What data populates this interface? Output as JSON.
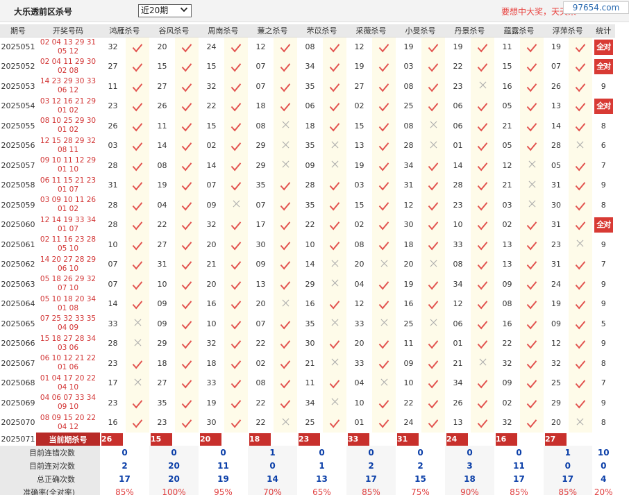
{
  "header": {
    "title": "大乐透前区杀号",
    "period_select": "近20期",
    "slogan": "要想中大奖，天天来",
    "watermark": "97654.com"
  },
  "columns": {
    "issue": "期号",
    "draw": "开奖号码",
    "experts": [
      "鸿雁杀号",
      "谷风杀号",
      "周南杀号",
      "蒹之杀号",
      "芣苡杀号",
      "采薇杀号",
      "小旻杀号",
      "丹景杀号",
      "蕴露杀号",
      "浮萍杀号"
    ],
    "stat": "统计"
  },
  "rows": [
    {
      "issue": "2025051",
      "draw1": "02 04 13 29 31",
      "draw2": "05 12",
      "kills": [
        "32",
        "20",
        "24",
        "12",
        "08",
        "12",
        "19",
        "19",
        "11",
        "19"
      ],
      "ok": [
        1,
        1,
        1,
        1,
        1,
        1,
        1,
        1,
        1,
        1
      ],
      "stat": "全对",
      "all": true
    },
    {
      "issue": "2025052",
      "draw1": "02 04 11 29 30",
      "draw2": "02 08",
      "kills": [
        "27",
        "15",
        "15",
        "07",
        "34",
        "19",
        "03",
        "22",
        "15",
        "07"
      ],
      "ok": [
        1,
        1,
        1,
        1,
        1,
        1,
        1,
        1,
        1,
        1
      ],
      "stat": "全对",
      "all": true
    },
    {
      "issue": "2025053",
      "draw1": "14 23 29 30 33",
      "draw2": "06 12",
      "kills": [
        "11",
        "27",
        "32",
        "07",
        "35",
        "27",
        "08",
        "23",
        "16",
        "26"
      ],
      "ok": [
        1,
        1,
        1,
        1,
        1,
        1,
        1,
        0,
        1,
        1
      ],
      "stat": "9",
      "all": false
    },
    {
      "issue": "2025054",
      "draw1": "03 12 16 21 29",
      "draw2": "01 02",
      "kills": [
        "23",
        "26",
        "22",
        "18",
        "06",
        "02",
        "25",
        "06",
        "05",
        "13"
      ],
      "ok": [
        1,
        1,
        1,
        1,
        1,
        1,
        1,
        1,
        1,
        1
      ],
      "stat": "全对",
      "all": true
    },
    {
      "issue": "2025055",
      "draw1": "08 10 25 29 30",
      "draw2": "01 02",
      "kills": [
        "26",
        "11",
        "15",
        "08",
        "18",
        "15",
        "08",
        "06",
        "21",
        "14"
      ],
      "ok": [
        1,
        1,
        1,
        0,
        1,
        1,
        0,
        1,
        1,
        1
      ],
      "stat": "8",
      "all": false
    },
    {
      "issue": "2025056",
      "draw1": "12 15 28 29 32",
      "draw2": "08 11",
      "kills": [
        "03",
        "14",
        "02",
        "29",
        "35",
        "13",
        "28",
        "01",
        "05",
        "28"
      ],
      "ok": [
        1,
        1,
        1,
        0,
        0,
        1,
        0,
        1,
        1,
        0
      ],
      "stat": "6",
      "all": false
    },
    {
      "issue": "2025057",
      "draw1": "09 10 11 12 29",
      "draw2": "01 10",
      "kills": [
        "28",
        "08",
        "14",
        "29",
        "09",
        "19",
        "34",
        "14",
        "12",
        "05"
      ],
      "ok": [
        1,
        1,
        1,
        0,
        0,
        1,
        1,
        1,
        0,
        1
      ],
      "stat": "7",
      "all": false
    },
    {
      "issue": "2025058",
      "draw1": "06 11 15 21 23",
      "draw2": "01 07",
      "kills": [
        "31",
        "19",
        "07",
        "35",
        "28",
        "03",
        "31",
        "28",
        "21",
        "31"
      ],
      "ok": [
        1,
        1,
        1,
        1,
        1,
        1,
        1,
        1,
        0,
        1
      ],
      "stat": "9",
      "all": false
    },
    {
      "issue": "2025059",
      "draw1": "03 09 10 11 26",
      "draw2": "01 02",
      "kills": [
        "28",
        "04",
        "09",
        "07",
        "35",
        "15",
        "12",
        "23",
        "03",
        "30"
      ],
      "ok": [
        1,
        1,
        0,
        1,
        1,
        1,
        1,
        1,
        0,
        1
      ],
      "stat": "8",
      "all": false
    },
    {
      "issue": "2025060",
      "draw1": "12 14 19 33 34",
      "draw2": "01 07",
      "kills": [
        "28",
        "22",
        "32",
        "17",
        "22",
        "02",
        "30",
        "10",
        "02",
        "31"
      ],
      "ok": [
        1,
        1,
        1,
        1,
        1,
        1,
        1,
        1,
        1,
        1
      ],
      "stat": "全对",
      "all": true
    },
    {
      "issue": "2025061",
      "draw1": "02 11 16 23 28",
      "draw2": "05 10",
      "kills": [
        "10",
        "27",
        "20",
        "30",
        "10",
        "08",
        "18",
        "33",
        "13",
        "23"
      ],
      "ok": [
        1,
        1,
        1,
        1,
        1,
        1,
        1,
        1,
        1,
        0
      ],
      "stat": "9",
      "all": false
    },
    {
      "issue": "2025062",
      "draw1": "14 20 27 28 29",
      "draw2": "06 10",
      "kills": [
        "07",
        "31",
        "21",
        "09",
        "14",
        "20",
        "20",
        "08",
        "13",
        "31"
      ],
      "ok": [
        1,
        1,
        1,
        1,
        0,
        0,
        0,
        1,
        1,
        1
      ],
      "stat": "7",
      "all": false
    },
    {
      "issue": "2025063",
      "draw1": "05 18 26 29 32",
      "draw2": "07 10",
      "kills": [
        "07",
        "10",
        "20",
        "13",
        "29",
        "04",
        "19",
        "34",
        "09",
        "24"
      ],
      "ok": [
        1,
        1,
        1,
        1,
        0,
        1,
        1,
        1,
        1,
        1
      ],
      "stat": "9",
      "all": false
    },
    {
      "issue": "2025064",
      "draw1": "05 10 18 20 34",
      "draw2": "01 08",
      "kills": [
        "14",
        "09",
        "16",
        "20",
        "16",
        "12",
        "16",
        "12",
        "08",
        "19"
      ],
      "ok": [
        1,
        1,
        1,
        0,
        1,
        1,
        1,
        1,
        1,
        1
      ],
      "stat": "9",
      "all": false
    },
    {
      "issue": "2025065",
      "draw1": "07 25 32 33 35",
      "draw2": "04 09",
      "kills": [
        "33",
        "09",
        "10",
        "07",
        "35",
        "33",
        "25",
        "06",
        "16",
        "09"
      ],
      "ok": [
        0,
        1,
        1,
        1,
        0,
        0,
        0,
        1,
        1,
        1
      ],
      "stat": "5",
      "all": false
    },
    {
      "issue": "2025066",
      "draw1": "15 18 27 28 34",
      "draw2": "03 06",
      "kills": [
        "28",
        "29",
        "32",
        "22",
        "30",
        "20",
        "11",
        "01",
        "22",
        "12"
      ],
      "ok": [
        0,
        1,
        1,
        1,
        1,
        1,
        1,
        1,
        1,
        1
      ],
      "stat": "9",
      "all": false
    },
    {
      "issue": "2025067",
      "draw1": "06 10 12 21 22",
      "draw2": "01 06",
      "kills": [
        "23",
        "18",
        "18",
        "02",
        "21",
        "33",
        "09",
        "21",
        "32",
        "32"
      ],
      "ok": [
        1,
        1,
        1,
        1,
        0,
        1,
        1,
        0,
        1,
        1
      ],
      "stat": "8",
      "all": false
    },
    {
      "issue": "2025068",
      "draw1": "01 04 17 20 22",
      "draw2": "04 10",
      "kills": [
        "17",
        "27",
        "33",
        "08",
        "11",
        "04",
        "10",
        "34",
        "09",
        "25"
      ],
      "ok": [
        0,
        1,
        1,
        1,
        1,
        0,
        1,
        1,
        1,
        1
      ],
      "stat": "7",
      "all": false
    },
    {
      "issue": "2025069",
      "draw1": "04 06 07 33 34",
      "draw2": "09 10",
      "kills": [
        "23",
        "35",
        "19",
        "22",
        "34",
        "10",
        "22",
        "26",
        "02",
        "29"
      ],
      "ok": [
        1,
        1,
        1,
        1,
        0,
        1,
        1,
        1,
        1,
        1
      ],
      "stat": "9",
      "all": false
    },
    {
      "issue": "2025070",
      "draw1": "08 09 15 20 22",
      "draw2": "04 12",
      "kills": [
        "16",
        "23",
        "30",
        "22",
        "25",
        "01",
        "24",
        "13",
        "32",
        "20"
      ],
      "ok": [
        1,
        1,
        1,
        0,
        1,
        1,
        1,
        1,
        1,
        0
      ],
      "stat": "8",
      "all": false
    }
  ],
  "current": {
    "issue": "2025071",
    "label": "当前期杀号",
    "kills": [
      "26",
      "15",
      "20",
      "18",
      "23",
      "33",
      "31",
      "24",
      "16",
      "27"
    ]
  },
  "stats": [
    {
      "label": "目前连错次数",
      "values": [
        "0",
        "0",
        "0",
        "1",
        "0",
        "0",
        "0",
        "0",
        "0",
        "1"
      ],
      "total": "10",
      "color": "blue"
    },
    {
      "label": "目前连对次数",
      "values": [
        "2",
        "20",
        "11",
        "0",
        "1",
        "2",
        "2",
        "3",
        "11",
        "0"
      ],
      "total": "0",
      "color": "blue"
    },
    {
      "label": "总正确次数",
      "values": [
        "17",
        "20",
        "19",
        "14",
        "13",
        "17",
        "15",
        "18",
        "17",
        "17"
      ],
      "total": "4",
      "color": "blue"
    },
    {
      "label": "准确率(全对率)",
      "values": [
        "85%",
        "100%",
        "95%",
        "70%",
        "65%",
        "85%",
        "75%",
        "90%",
        "85%",
        "85%"
      ],
      "total": "20%",
      "color": "red"
    }
  ]
}
